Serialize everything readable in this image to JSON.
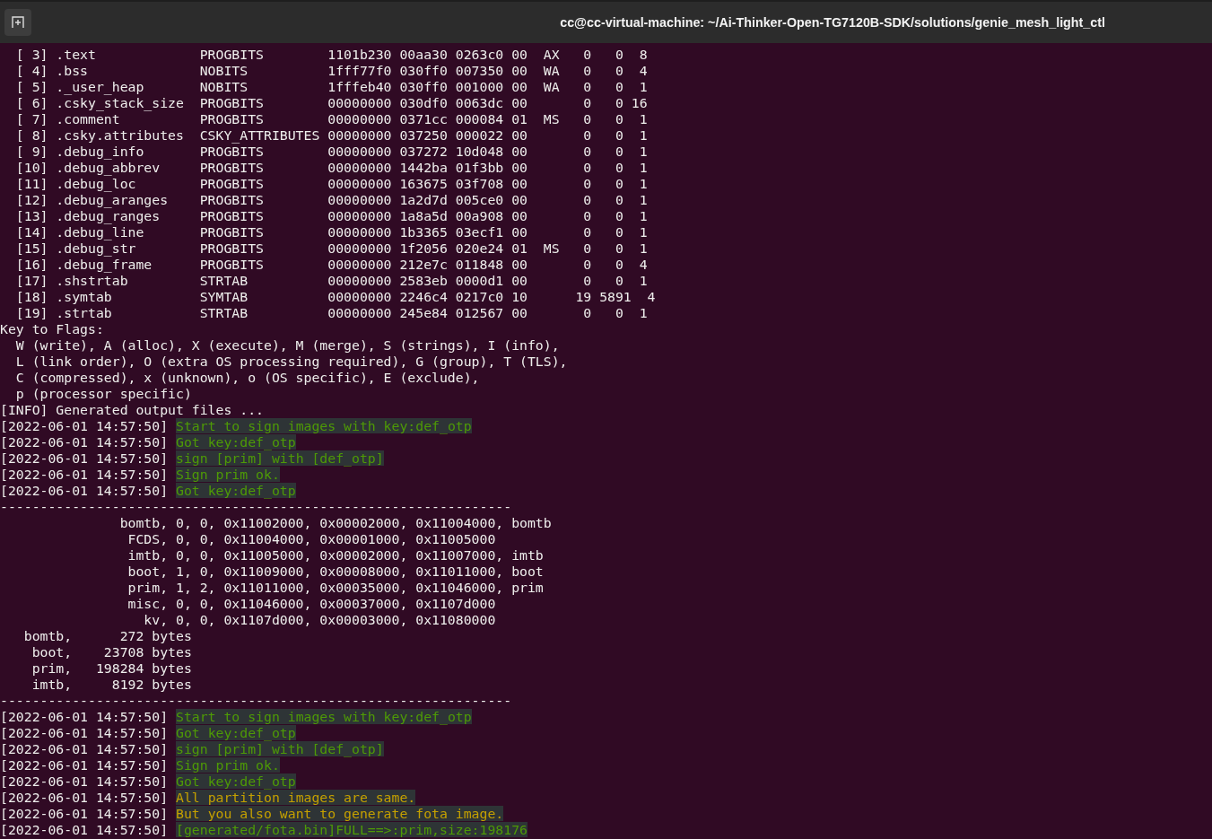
{
  "window": {
    "title": "cc@cc-virtual-machine: ~/Ai-Thinker-Open-TG7120B-SDK/solutions/genie_mesh_light_ctl"
  },
  "lines": [
    {
      "kind": "text",
      "text": "  [ 3] .text             PROGBITS        1101b230 00aa30 0263c0 00  AX   0   0  8"
    },
    {
      "kind": "text",
      "text": "  [ 4] .bss              NOBITS          1fff77f0 030ff0 007350 00  WA   0   0  4"
    },
    {
      "kind": "text",
      "text": "  [ 5] ._user_heap       NOBITS          1fffeb40 030ff0 001000 00  WA   0   0  1"
    },
    {
      "kind": "text",
      "text": "  [ 6] .csky_stack_size  PROGBITS        00000000 030df0 0063dc 00       0   0 16"
    },
    {
      "kind": "text",
      "text": "  [ 7] .comment          PROGBITS        00000000 0371cc 000084 01  MS   0   0  1"
    },
    {
      "kind": "text",
      "text": "  [ 8] .csky.attributes  CSKY_ATTRIBUTES 00000000 037250 000022 00       0   0  1"
    },
    {
      "kind": "text",
      "text": "  [ 9] .debug_info       PROGBITS        00000000 037272 10d048 00       0   0  1"
    },
    {
      "kind": "text",
      "text": "  [10] .debug_abbrev     PROGBITS        00000000 1442ba 01f3bb 00       0   0  1"
    },
    {
      "kind": "text",
      "text": "  [11] .debug_loc        PROGBITS        00000000 163675 03f708 00       0   0  1"
    },
    {
      "kind": "text",
      "text": "  [12] .debug_aranges    PROGBITS        00000000 1a2d7d 005ce0 00       0   0  1"
    },
    {
      "kind": "text",
      "text": "  [13] .debug_ranges     PROGBITS        00000000 1a8a5d 00a908 00       0   0  1"
    },
    {
      "kind": "text",
      "text": "  [14] .debug_line       PROGBITS        00000000 1b3365 03ecf1 00       0   0  1"
    },
    {
      "kind": "text",
      "text": "  [15] .debug_str        PROGBITS        00000000 1f2056 020e24 01  MS   0   0  1"
    },
    {
      "kind": "text",
      "text": "  [16] .debug_frame      PROGBITS        00000000 212e7c 011848 00       0   0  4"
    },
    {
      "kind": "text",
      "text": "  [17] .shstrtab         STRTAB          00000000 2583eb 0000d1 00       0   0  1"
    },
    {
      "kind": "text",
      "text": "  [18] .symtab           SYMTAB          00000000 2246c4 0217c0 10      19 5891  4"
    },
    {
      "kind": "text",
      "text": "  [19] .strtab           STRTAB          00000000 245e84 012567 00       0   0  1"
    },
    {
      "kind": "text",
      "text": "Key to Flags:"
    },
    {
      "kind": "text",
      "text": "  W (write), A (alloc), X (execute), M (merge), S (strings), I (info),"
    },
    {
      "kind": "text",
      "text": "  L (link order), O (extra OS processing required), G (group), T (TLS),"
    },
    {
      "kind": "text",
      "text": "  C (compressed), x (unknown), o (OS specific), E (exclude),"
    },
    {
      "kind": "text",
      "text": "  p (processor specific)"
    },
    {
      "kind": "text",
      "text": "[INFO] Generated output files ..."
    },
    {
      "kind": "success",
      "stamp": "[2022-06-01 14:57:50]",
      "message": "Start to sign images with key:def_otp"
    },
    {
      "kind": "success",
      "stamp": "[2022-06-01 14:57:50]",
      "message": "Got key:def_otp"
    },
    {
      "kind": "success",
      "stamp": "[2022-06-01 14:57:50]",
      "message": "sign [prim] with [def_otp]"
    },
    {
      "kind": "success",
      "stamp": "[2022-06-01 14:57:50]",
      "message": "Sign prim ok."
    },
    {
      "kind": "success",
      "stamp": "[2022-06-01 14:57:50]",
      "message": "Got key:def_otp"
    },
    {
      "kind": "text",
      "text": "----------------------------------------------------------------"
    },
    {
      "kind": "text",
      "text": "               bomtb, 0, 0, 0x11002000, 0x00002000, 0x11004000, bomtb"
    },
    {
      "kind": "text",
      "text": "                FCDS, 0, 0, 0x11004000, 0x00001000, 0x11005000"
    },
    {
      "kind": "text",
      "text": "                imtb, 0, 0, 0x11005000, 0x00002000, 0x11007000, imtb"
    },
    {
      "kind": "text",
      "text": "                boot, 1, 0, 0x11009000, 0x00008000, 0x11011000, boot"
    },
    {
      "kind": "text",
      "text": "                prim, 1, 2, 0x11011000, 0x00035000, 0x11046000, prim"
    },
    {
      "kind": "text",
      "text": "                misc, 0, 0, 0x11046000, 0x00037000, 0x1107d000"
    },
    {
      "kind": "text",
      "text": "                  kv, 0, 0, 0x1107d000, 0x00003000, 0x11080000"
    },
    {
      "kind": "text",
      "text": "   bomtb,      272 bytes"
    },
    {
      "kind": "text",
      "text": "    boot,    23708 bytes"
    },
    {
      "kind": "text",
      "text": "    prim,   198284 bytes"
    },
    {
      "kind": "text",
      "text": "    imtb,     8192 bytes"
    },
    {
      "kind": "text",
      "text": "----------------------------------------------------------------"
    },
    {
      "kind": "success",
      "stamp": "[2022-06-01 14:57:50]",
      "message": "Start to sign images with key:def_otp"
    },
    {
      "kind": "success",
      "stamp": "[2022-06-01 14:57:50]",
      "message": "Got key:def_otp"
    },
    {
      "kind": "success",
      "stamp": "[2022-06-01 14:57:50]",
      "message": "sign [prim] with [def_otp]"
    },
    {
      "kind": "success",
      "stamp": "[2022-06-01 14:57:50]",
      "message": "Sign prim ok."
    },
    {
      "kind": "success",
      "stamp": "[2022-06-01 14:57:50]",
      "message": "Got key:def_otp"
    },
    {
      "kind": "warning",
      "stamp": "[2022-06-01 14:57:50]",
      "message": "All partition images are same."
    },
    {
      "kind": "warning",
      "stamp": "[2022-06-01 14:57:50]",
      "message": "But you also want to generate fota image."
    },
    {
      "kind": "success",
      "stamp": "[2022-06-01 14:57:50]",
      "message": "[generated/fota.bin]FULL==>:prim,size:198176"
    }
  ]
}
